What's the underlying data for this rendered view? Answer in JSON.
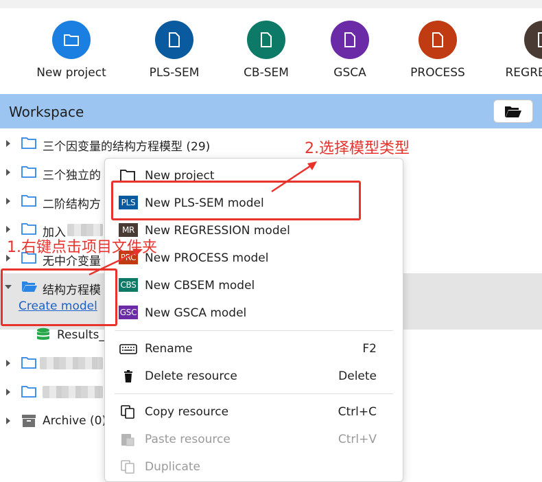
{
  "toolbar": {
    "items": [
      {
        "label": "New project",
        "color": "#1a7fe0"
      },
      {
        "label": "PLS-SEM",
        "color": "#0a5aa0"
      },
      {
        "label": "CB-SEM",
        "color": "#0d7a68"
      },
      {
        "label": "GSCA",
        "color": "#6b2aa6"
      },
      {
        "label": "PROCESS",
        "color": "#c03a12"
      },
      {
        "label": "REGRESSION",
        "color": "#4a3a34"
      }
    ]
  },
  "workspace": {
    "title": "Workspace",
    "tree": [
      {
        "label": "三个因变量的结构方程模型 (29)"
      },
      {
        "label": "三个独立的"
      },
      {
        "label": "二阶结构方"
      },
      {
        "label": "加入"
      },
      {
        "label": "无中介变量"
      },
      {
        "label": "结构方程模"
      },
      {
        "label": ""
      },
      {
        "label": ""
      },
      {
        "label": "Archive (0)"
      }
    ],
    "create_model": "Create model",
    "results_label": "Results_"
  },
  "context_menu": {
    "items": [
      {
        "label": "New project",
        "badge": ""
      },
      {
        "label": "New PLS-SEM model",
        "badge": "PLS",
        "color": "#0a5aa0"
      },
      {
        "label": "New REGRESSION model",
        "badge": "MR",
        "color": "#4a3a34"
      },
      {
        "label": "New PROCESS model",
        "badge": "PRC",
        "color": "#c03a12"
      },
      {
        "label": "New CBSEM model",
        "badge": "CBS",
        "color": "#0d7a68"
      },
      {
        "label": "New GSCA model",
        "badge": "GSC",
        "color": "#6b2aa6"
      },
      {
        "label": "Rename",
        "shortcut": "F2"
      },
      {
        "label": "Delete resource",
        "shortcut": "Delete"
      },
      {
        "label": "Copy resource",
        "shortcut": "Ctrl+C"
      },
      {
        "label": "Paste resource",
        "shortcut": "Ctrl+V"
      },
      {
        "label": "Duplicate",
        "shortcut": ""
      }
    ]
  },
  "annotations": {
    "step1": "1.右键点击项目文件夹",
    "step2": "2.选择模型类型",
    "color": "#e8332d"
  }
}
